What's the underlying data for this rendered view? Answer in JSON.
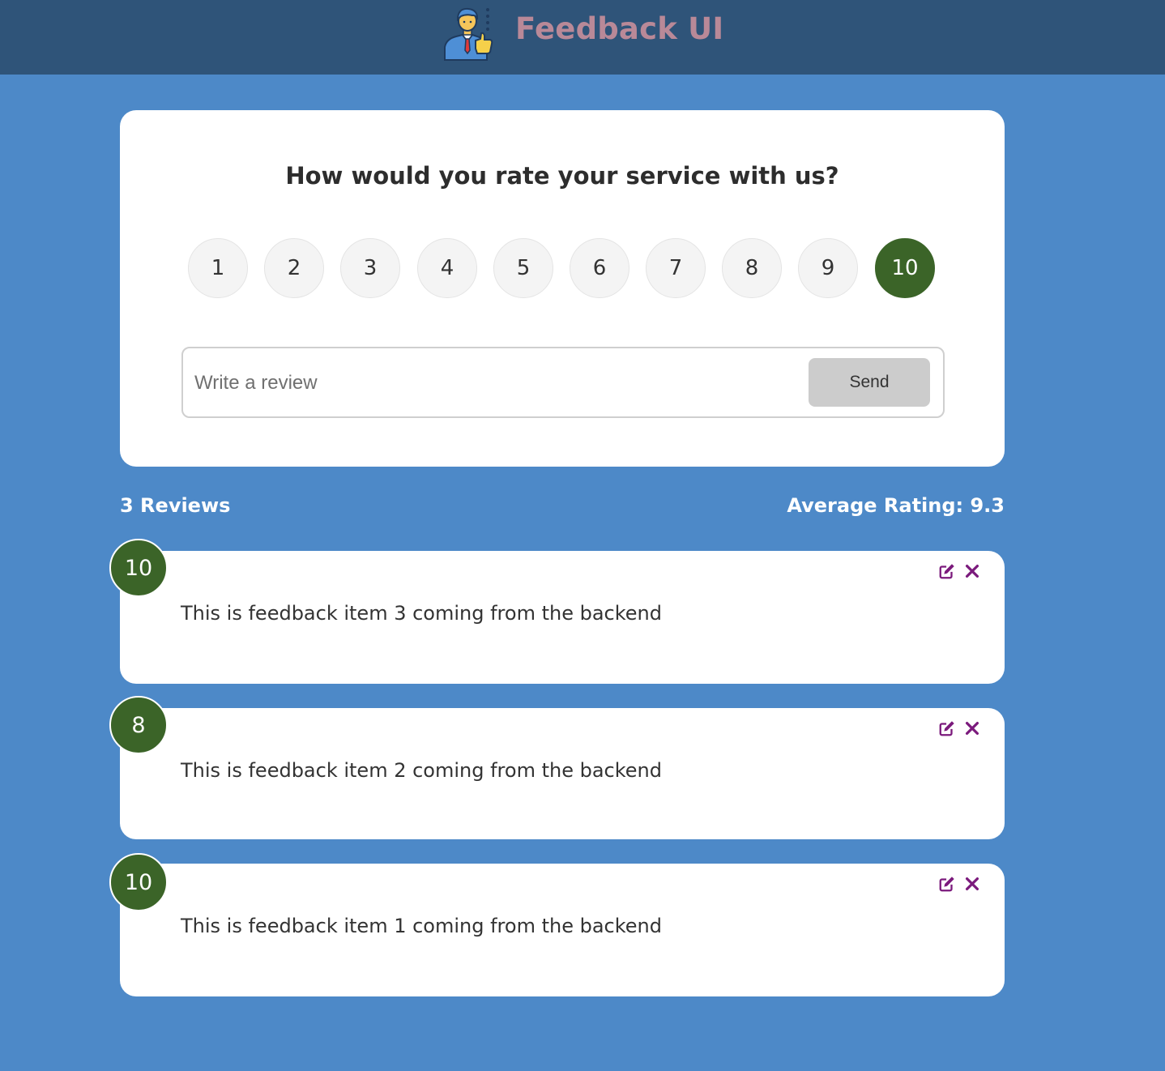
{
  "header": {
    "title": "Feedback UI",
    "logo_icon": "businessman-thumbs-up-icon"
  },
  "rating_form": {
    "question": "How would you rate your service with us?",
    "options": [
      "1",
      "2",
      "3",
      "4",
      "5",
      "6",
      "7",
      "8",
      "9",
      "10"
    ],
    "selected": "10",
    "review_placeholder": "Write a review",
    "review_value": "",
    "send_label": "Send"
  },
  "stats": {
    "count_label": "3 Reviews",
    "average_label": "Average Rating: 9.3"
  },
  "feedback_items": [
    {
      "rating": "10",
      "text": "This is feedback item 3 coming from the backend"
    },
    {
      "rating": "8",
      "text": "This is feedback item 2 coming from the backend"
    },
    {
      "rating": "10",
      "text": "This is feedback item 1 coming from the backend"
    }
  ],
  "colors": {
    "background": "#4d89c8",
    "header": "#2f5479",
    "title": "#b98998",
    "selected_rating": "#3b6428",
    "action_icons": "#7b1a7c"
  }
}
